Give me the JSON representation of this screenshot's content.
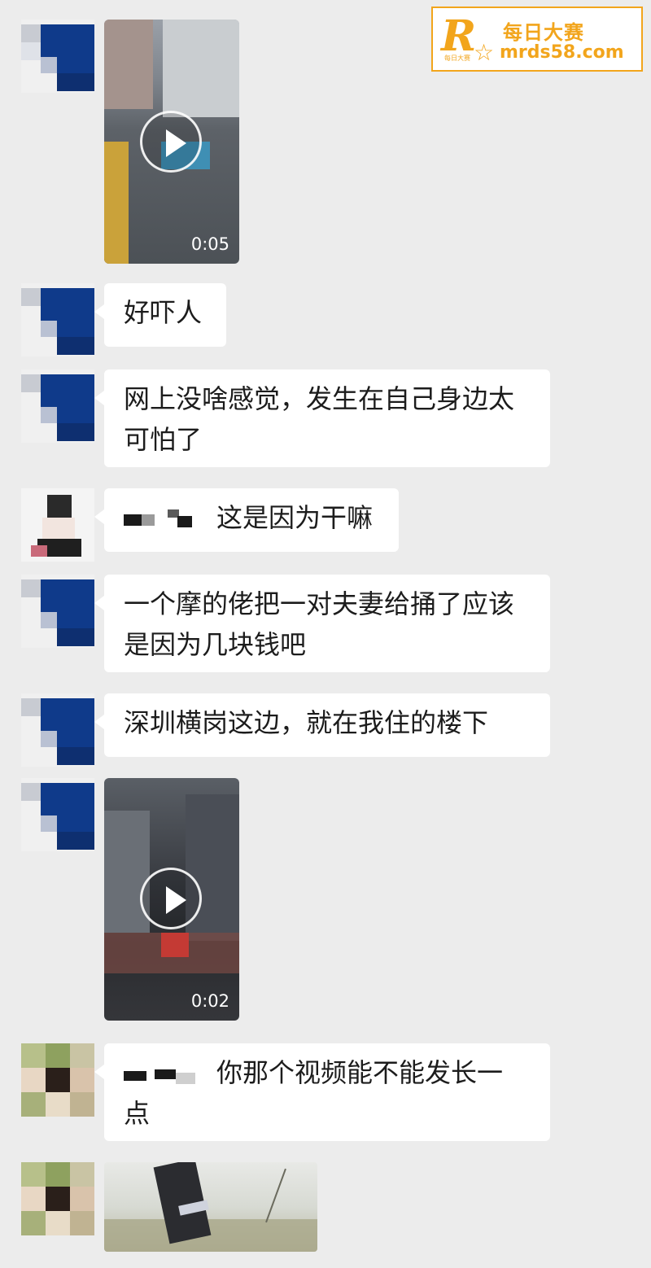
{
  "watermark": {
    "brand_name": "每日大赛",
    "url": "mrds58.com",
    "tiny": "每日大赛",
    "accent": "#f2a51c"
  },
  "messages": [
    {
      "type": "video",
      "duration": "0:05"
    },
    {
      "type": "text",
      "text": "好吓人"
    },
    {
      "type": "text",
      "lines": [
        "网上没啥感觉，发生在自己身边太",
        "可怕了"
      ]
    },
    {
      "type": "text",
      "text": "这是因为干嘛",
      "has_redacted_mention": true
    },
    {
      "type": "text",
      "lines": [
        "一个摩的佬把一对夫妻给捅了应该",
        "是因为几块钱吧"
      ]
    },
    {
      "type": "text",
      "text": "深圳横岗这边，就在我住的楼下"
    },
    {
      "type": "video",
      "duration": "0:02"
    },
    {
      "type": "text",
      "lines": [
        "你那个视频能不能发长一",
        "点"
      ],
      "has_redacted_mention": true
    },
    {
      "type": "image"
    }
  ],
  "colors": {
    "background": "#ececec",
    "bubble": "#ffffff",
    "text": "#1c1c1c"
  }
}
